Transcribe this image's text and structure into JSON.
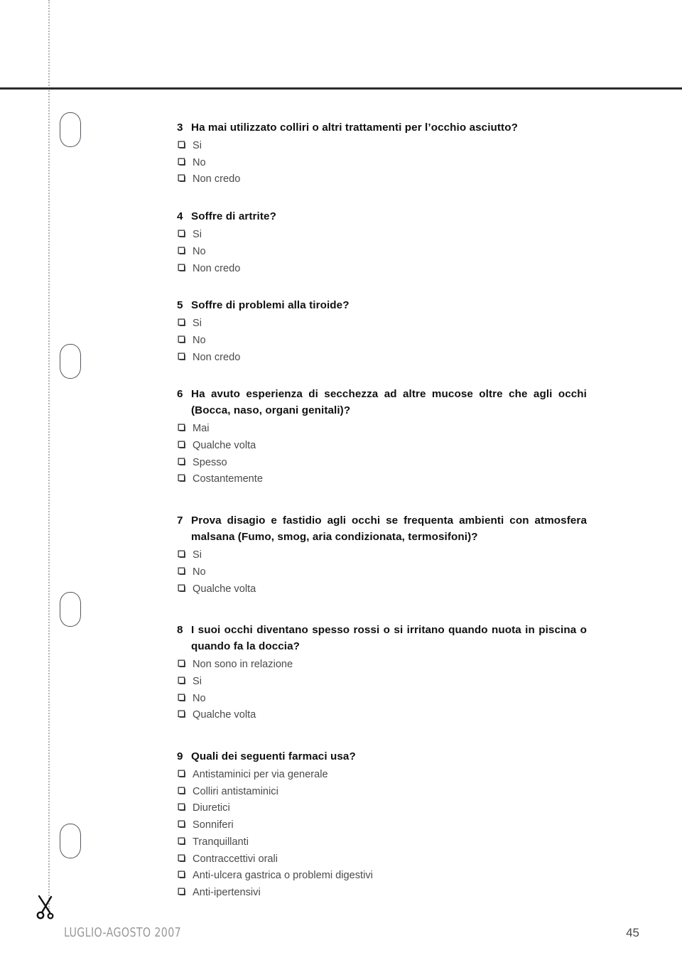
{
  "page": {
    "footer_issue": "LUGLIO-AGOSTO 2007",
    "page_number": "45",
    "checkbox_glyph": "empty-checkbox",
    "cut_marker": "scissors-icon",
    "punch_holes": 4
  },
  "questions": [
    {
      "number": "3",
      "text": "Ha mai utilizzato colliri o altri trattamenti per l’occhio asciutto?",
      "multiline": false,
      "options": [
        "Si",
        "No",
        "Non credo"
      ]
    },
    {
      "number": "4",
      "text": "Soffre di artrite?",
      "multiline": false,
      "options": [
        "Si",
        "No",
        "Non credo"
      ]
    },
    {
      "number": "5",
      "text": "Soffre di problemi alla tiroide?",
      "multiline": false,
      "options": [
        "Si",
        "No",
        "Non credo"
      ]
    },
    {
      "number": "6",
      "text": "Ha avuto esperienza di secchezza ad altre mucose oltre che agli occhi (Bocca, naso, organi genitali)?",
      "multiline": true,
      "options": [
        "Mai",
        "Qualche volta",
        "Spesso",
        "Costantemente"
      ]
    },
    {
      "number": "7",
      "text": "Prova disagio e fastidio agli occhi se frequenta ambienti con atmosfera malsana (Fumo, smog, aria condizionata, termosifoni)?",
      "multiline": true,
      "options": [
        "Si",
        "No",
        "Qualche volta"
      ]
    },
    {
      "number": "8",
      "text": "I suoi occhi diventano spesso rossi o si irritano quando nuota in piscina o quando fa la doccia?",
      "multiline": true,
      "options": [
        "Non sono in relazione",
        "Si",
        "No",
        "Qualche volta"
      ]
    },
    {
      "number": "9",
      "text": "Quali dei seguenti farmaci usa?",
      "multiline": false,
      "options": [
        "Antistaminici per via generale",
        "Colliri antistaminici",
        "Diuretici",
        "Sonniferi",
        "Tranquillanti",
        "Contraccettivi orali",
        "Anti-ulcera gastrica o problemi digestivi",
        "Anti-ipertensivi"
      ]
    }
  ],
  "colors": {
    "rule": "#2b2b2b",
    "cut_line": "#b3b3b3",
    "question_text": "#101010",
    "option_text": "#4a4a4a",
    "footer_issue": "#9a9a9a",
    "hole_outline": "#55555d"
  }
}
